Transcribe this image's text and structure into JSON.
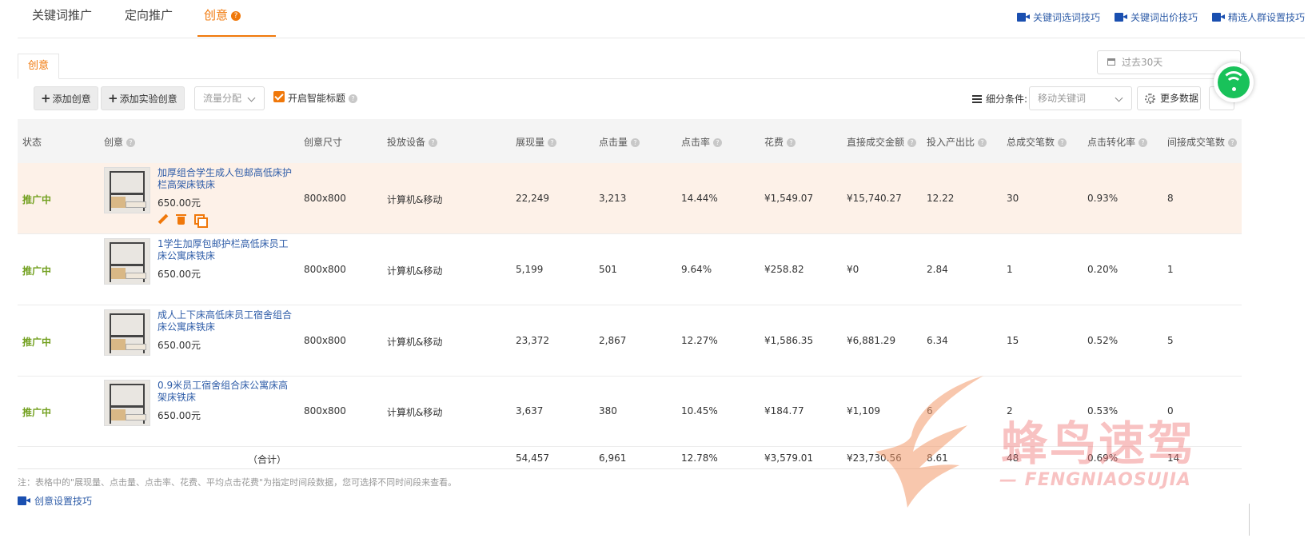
{
  "top_tabs": [
    {
      "label": "关键词推广",
      "active": false
    },
    {
      "label": "定向推广",
      "active": false
    },
    {
      "label": "创意",
      "active": true
    }
  ],
  "top_links": [
    "关键词选词技巧",
    "关键词出价技巧",
    "精选人群设置技巧"
  ],
  "sub_tab": "创意",
  "date_range": {
    "placeholder": "过去30天"
  },
  "toolbar": {
    "add_creative": "添加创意",
    "add_experiment": "添加实验创意",
    "traffic_select": "流量分配",
    "smart_title_label": "开启智能标题",
    "smart_title_checked": true,
    "filter_label": "细分条件:",
    "filter_value": "移动关键词",
    "more_data": "更多数据"
  },
  "table": {
    "headers": [
      "状态",
      "创意",
      "创意尺寸",
      "投放设备",
      "展现量",
      "点击量",
      "点击率",
      "花费",
      "直接成交金额",
      "投入产出比",
      "总成交笔数",
      "点击转化率",
      "间接成交笔数"
    ],
    "rows": [
      {
        "status": "推广中",
        "title": "加厚组合学生成人包邮高低床护栏高架床铁床",
        "price": "650.00元",
        "size": "800x800",
        "device": "计算机&移动",
        "impressions": "22,249",
        "clicks": "3,213",
        "ctr": "14.44%",
        "cost": "¥1,549.07",
        "direct_gmv": "¥15,740.27",
        "roi": "12.22",
        "total_orders": "30",
        "cvr": "0.93%",
        "indirect_orders": "8"
      },
      {
        "status": "推广中",
        "title": "1学生加厚包邮护栏高低床员工床公寓床铁床",
        "price": "650.00元",
        "size": "800x800",
        "device": "计算机&移动",
        "impressions": "5,199",
        "clicks": "501",
        "ctr": "9.64%",
        "cost": "¥258.82",
        "direct_gmv": "¥0",
        "roi": "2.84",
        "total_orders": "1",
        "cvr": "0.20%",
        "indirect_orders": "1"
      },
      {
        "status": "推广中",
        "title": "成人上下床高低床员工宿舍组合床公寓床铁床",
        "price": "650.00元",
        "size": "800x800",
        "device": "计算机&移动",
        "impressions": "23,372",
        "clicks": "2,867",
        "ctr": "12.27%",
        "cost": "¥1,586.35",
        "direct_gmv": "¥6,881.29",
        "roi": "6.34",
        "total_orders": "15",
        "cvr": "0.52%",
        "indirect_orders": "5"
      },
      {
        "status": "推广中",
        "title": "0.9米员工宿舍组合床公寓床高架床铁床",
        "price": "650.00元",
        "size": "800x800",
        "device": "计算机&移动",
        "impressions": "3,637",
        "clicks": "380",
        "ctr": "10.45%",
        "cost": "¥184.77",
        "direct_gmv": "¥1,109",
        "roi": "6",
        "total_orders": "2",
        "cvr": "0.53%",
        "indirect_orders": "0"
      }
    ],
    "total": {
      "label": "（合计）",
      "impressions": "54,457",
      "clicks": "6,961",
      "ctr": "12.78%",
      "cost": "¥3,579.01",
      "direct_gmv": "¥23,730.56",
      "roi": "8.61",
      "total_orders": "48",
      "cvr": "0.69%",
      "indirect_orders": "14"
    }
  },
  "note": "注：表格中的\"展现量、点击量、点击率、花费、平均点击花费\"为指定时间段数据，您可选择不同时间段来查看。",
  "bottom_link": "创意设置技巧",
  "watermark": {
    "cn": "蜂鸟速驾",
    "en": "— FENGNIAOSUJIA"
  },
  "colors": {
    "accent": "#f0780a",
    "link": "#2f5da8",
    "status_green": "#72a01f",
    "highlight_row": "#fdf1e8"
  }
}
